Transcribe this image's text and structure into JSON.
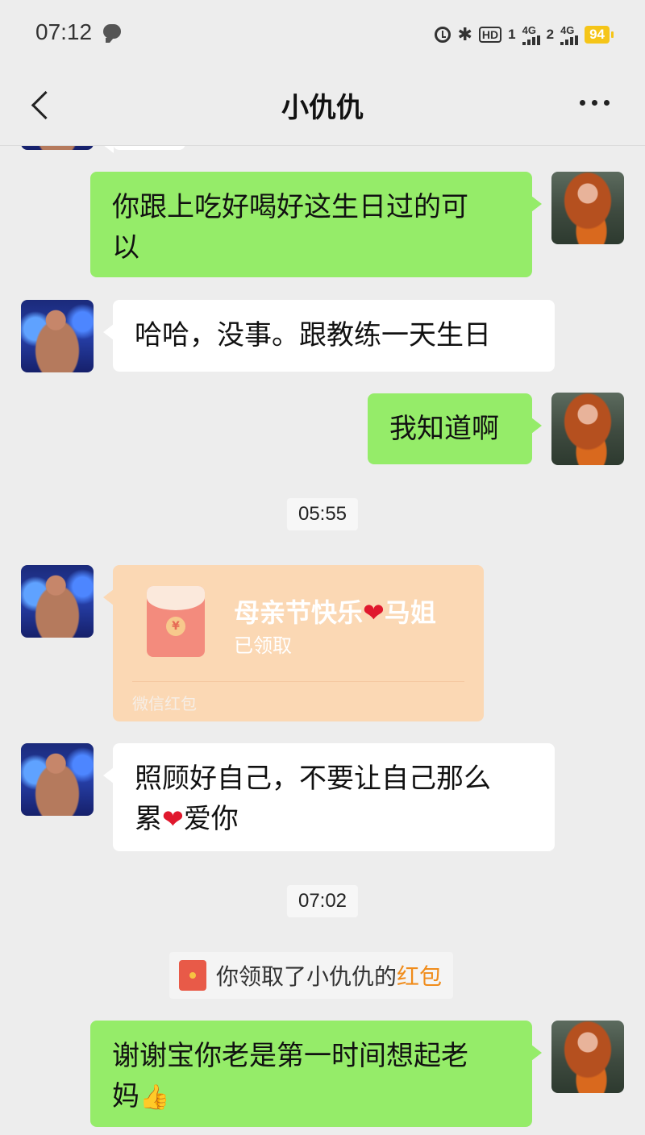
{
  "status_bar": {
    "time": "07:12",
    "bluetooth": "✱",
    "hd": "HD",
    "sim1": "4G",
    "sim2": "4G",
    "sim_index": "1",
    "sim_index2": "2",
    "battery": "94"
  },
  "header": {
    "title": "小仇仇"
  },
  "messages": [
    {
      "text_line1": "你跟上吃好喝好这生日过的可",
      "text_line2": "以"
    },
    {
      "text": "哈哈，没事。跟教练一天生日"
    },
    {
      "text": "我知道啊"
    },
    {
      "time": "05:55"
    },
    {
      "red_packet": {
        "title": "母亲节快乐",
        "title_suffix": "马姐",
        "status": "已领取",
        "footer": "微信红包"
      }
    },
    {
      "text_line1": "照顾好自己，不要让自己那么",
      "text_line2_pre": "累",
      "text_line2_post": "爱你"
    },
    {
      "time": "07:02"
    },
    {
      "system": {
        "pre": "你领取了小仇仇的",
        "link": "红包"
      }
    },
    {
      "text_line1": "谢谢宝你老是第一时间想起老",
      "text_line2": "妈"
    }
  ],
  "emoji": {
    "heart": "❤",
    "thumbs_up": "👍"
  },
  "colors": {
    "bubble_sent": "#95ec69",
    "bubble_received": "#ffffff",
    "background": "#ededed",
    "red_packet": "#fbd8b4",
    "link": "#f08c1b"
  }
}
